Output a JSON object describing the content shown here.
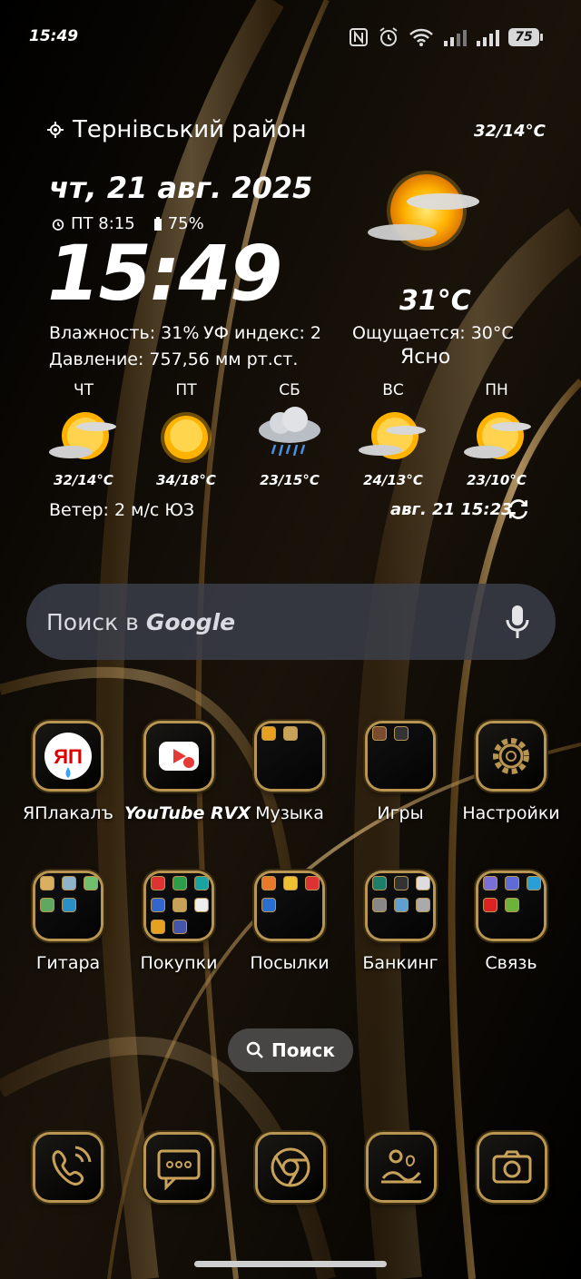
{
  "status_bar": {
    "time": "15:49",
    "battery": "75",
    "icons": [
      "nfc-icon",
      "alarm-icon",
      "wifi-icon",
      "signal-icon",
      "signal-icon",
      "battery-icon"
    ]
  },
  "weather": {
    "location": "Тернівський район",
    "today_range": "32/14°C",
    "date": "чт, 21 авг. 2025",
    "alarm": "ПТ 8:15",
    "battery_level": "75%",
    "clock": "15:49",
    "temperature": "31°C",
    "humidity": "Влажность: 31%",
    "uv_index": "УФ индекс: 2",
    "feels_like": "Ощущается: 30°C",
    "pressure": "Давление: 757,56 мм рт.ст.",
    "condition": "Ясно",
    "forecast": [
      {
        "day": "ЧТ",
        "range": "32/14°C",
        "icon": "partly-cloudy-icon"
      },
      {
        "day": "ПТ",
        "range": "34/18°C",
        "icon": "sunny-icon"
      },
      {
        "day": "СБ",
        "range": "23/15°C",
        "icon": "rain-cloud-icon"
      },
      {
        "day": "ВС",
        "range": "24/13°C",
        "icon": "partly-cloudy-icon"
      },
      {
        "day": "ПН",
        "range": "23/10°C",
        "icon": "partly-cloudy-icon"
      }
    ],
    "wind": "Ветер: 2 м/с ЮЗ",
    "updated": "авг. 21  15:23"
  },
  "search": {
    "label": "Поиск в",
    "brand": "Google"
  },
  "apps_row1": [
    {
      "label": "ЯПлакалъ"
    },
    {
      "label": "YouTube RVX"
    },
    {
      "label": "Музыка"
    },
    {
      "label": "Игры"
    },
    {
      "label": "Настройки"
    }
  ],
  "apps_row2": [
    {
      "label": "Гитара"
    },
    {
      "label": "Покупки"
    },
    {
      "label": "Посылки"
    },
    {
      "label": "Банкинг"
    },
    {
      "label": "Связь"
    }
  ],
  "app_search": {
    "label": "Поиск"
  },
  "dock": [
    "phone-icon",
    "messages-icon",
    "browser-icon",
    "gallery-icon",
    "camera-icon"
  ],
  "colors": {
    "accent_gold": "#c9a25a",
    "search_bar": "#3c404c",
    "sun": "#ffb300"
  }
}
